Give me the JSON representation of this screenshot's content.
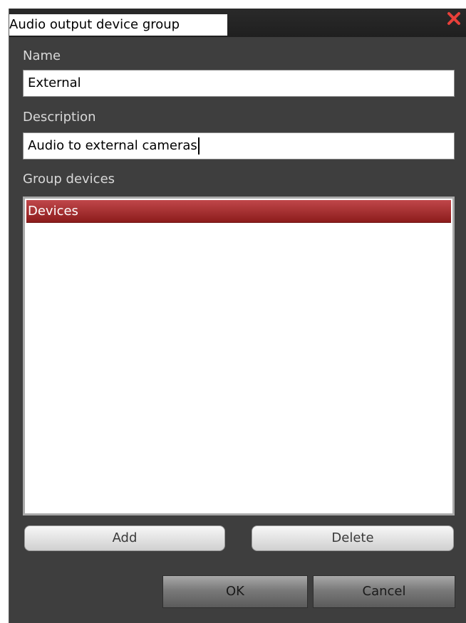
{
  "window": {
    "title": "Audio output device group"
  },
  "form": {
    "name_label": "Name",
    "name_value": "External",
    "description_label": "Description",
    "description_value": "Audio to external cameras",
    "group_devices_label": "Group devices"
  },
  "devices_list": {
    "items": [
      {
        "label": "Devices",
        "selected": true
      }
    ]
  },
  "buttons": {
    "add": "Add",
    "delete": "Delete",
    "ok": "OK",
    "cancel": "Cancel"
  },
  "icons": {
    "close": "close-icon"
  },
  "colors": {
    "dialog_background": "#3e3e3e",
    "titlebar": "#1f1f1f",
    "selection": "#a62a2c",
    "close_icon": "#e8403a"
  }
}
